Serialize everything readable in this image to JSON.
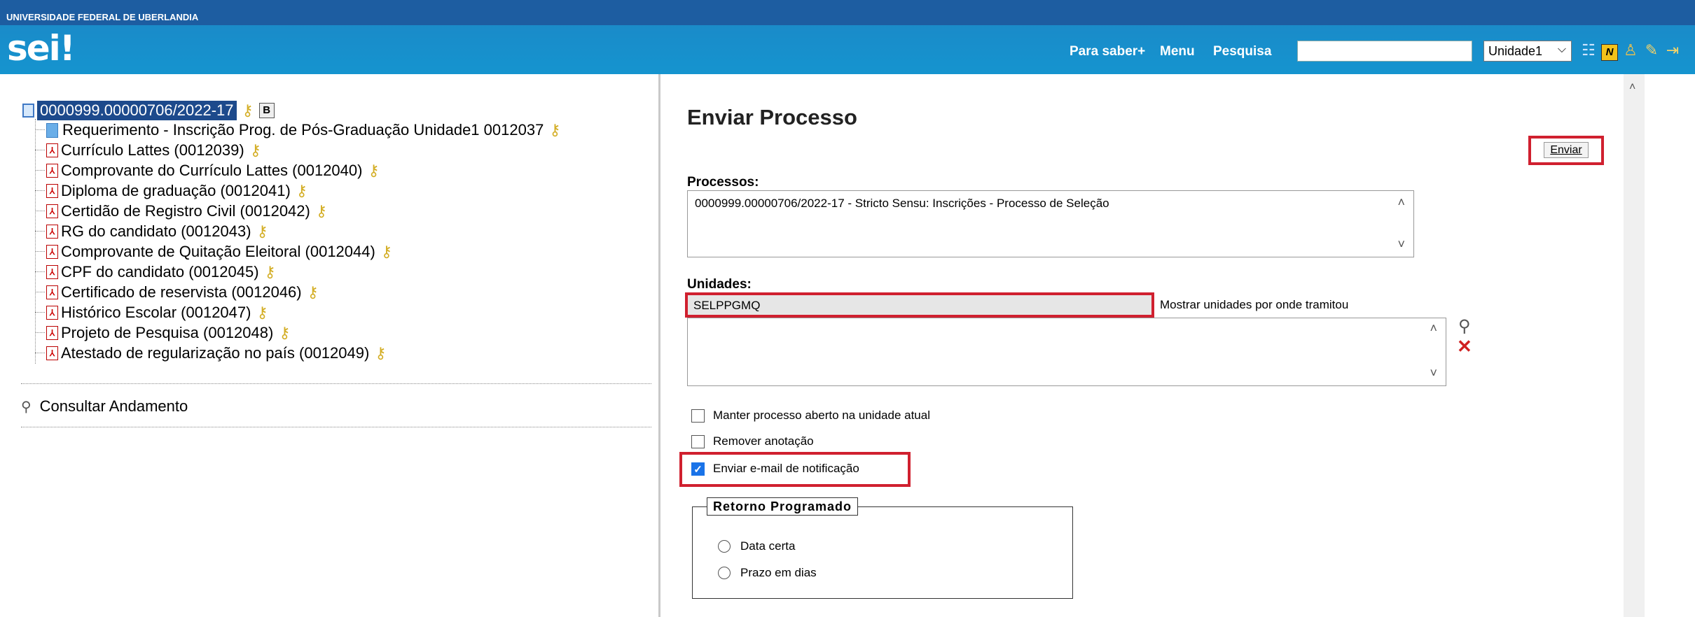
{
  "header": {
    "university": "UNIVERSIDADE FEDERAL DE UBERLANDIA",
    "logo": "sei",
    "logo_suffix": "!",
    "links": [
      "Para saber+",
      "Menu",
      "Pesquisa"
    ],
    "search_value": "",
    "unit_selected": "Unidade1",
    "icons": [
      "list-icon",
      "notes-icon",
      "user-icon",
      "wrench-icon",
      "exit-icon"
    ]
  },
  "tree": {
    "root": "0000999.00000706/2022-17",
    "root_badge": "B",
    "items": [
      "Requerimento - Inscrição Prog. de Pós-Graduação Unidade1 0012037",
      "Currículo Lattes (0012039)",
      "Comprovante do Currículo Lattes (0012040)",
      "Diploma de graduação (0012041)",
      "Certidão de Registro Civil (0012042)",
      "RG do candidato (0012043)",
      "Comprovante de Quitação Eleitoral (0012044)",
      "CPF do candidato (0012045)",
      "Certificado de reservista (0012046)",
      "Histórico Escolar (0012047)",
      "Projeto de Pesquisa (0012048)",
      "Atestado de regularização no país (0012049)"
    ],
    "consultar": "Consultar Andamento"
  },
  "form": {
    "title": "Enviar Processo",
    "send_label": "Enviar",
    "processes_label": "Processos:",
    "processes_value": "0000999.00000706/2022-17 - Stricto Sensu: Inscrições - Processo de Seleção",
    "units_label": "Unidades:",
    "units_value": "SELPPGMQ",
    "show_units_label": "Mostrar unidades por onde tramitou",
    "options": [
      {
        "label": "Manter processo aberto na unidade atual",
        "checked": false
      },
      {
        "label": "Remover anotação",
        "checked": false
      },
      {
        "label": "Enviar e-mail de notificação",
        "checked": true
      }
    ],
    "retorno_title": "Retorno Programado",
    "retorno_options": [
      "Data certa",
      "Prazo em dias"
    ]
  },
  "colors": {
    "header_top": "#1d5da1",
    "header_band": "#1594cf",
    "highlight_red": "#d0202f",
    "tree_selected": "#1d4a8c"
  }
}
